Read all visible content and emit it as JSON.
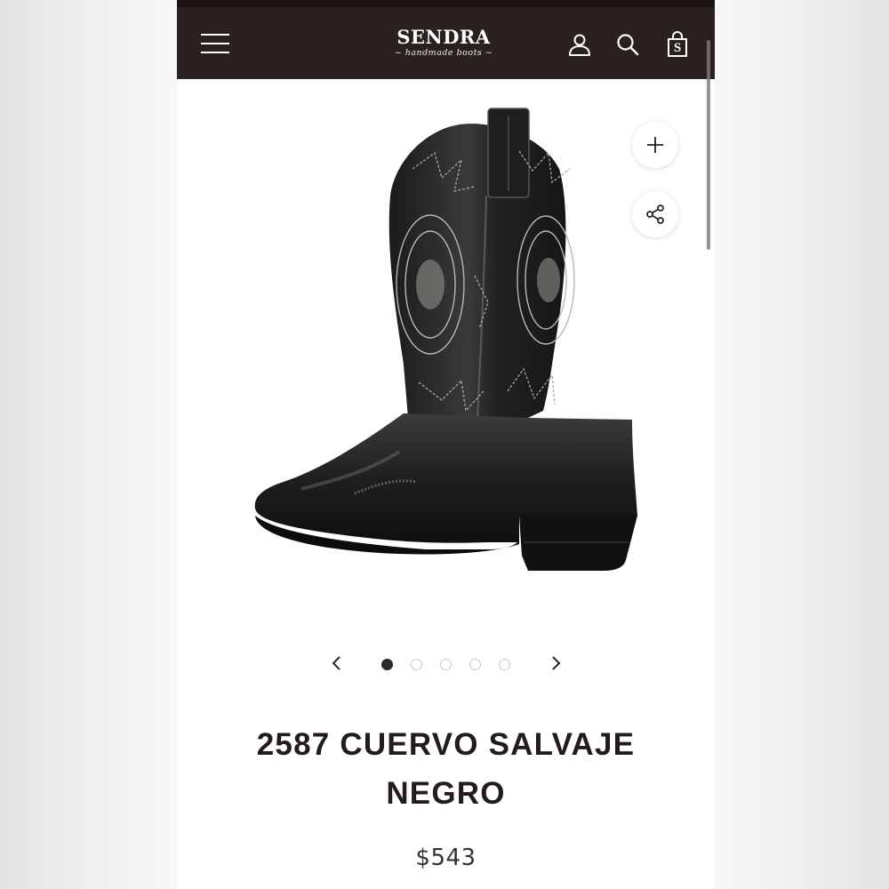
{
  "header": {
    "brand_name": "SENDRA",
    "brand_tagline": "~ handmade boots ~",
    "icons": [
      "menu-icon",
      "account-icon",
      "search-icon",
      "cart-icon"
    ],
    "cart_badge": "S",
    "background_color": "#2b2020"
  },
  "gallery": {
    "image_description_icon": "cowboy-boot-image",
    "zoom_icon": "plus-icon",
    "share_icon": "share-icon",
    "total_slides": 5,
    "active_slide": 1
  },
  "product": {
    "title": "2587 CUERVO SALVAJE NEGRO",
    "price": "$543"
  }
}
